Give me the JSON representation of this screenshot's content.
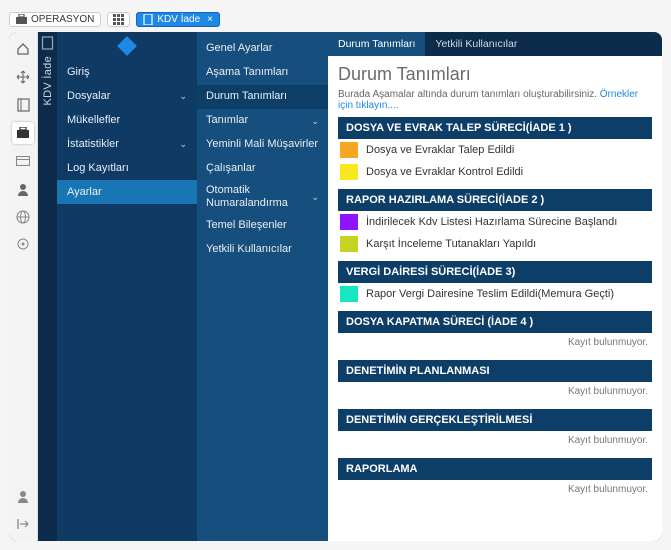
{
  "topbar": {
    "operasyon": "OPERASYON",
    "tab_label": "KDV İade",
    "tab_close": "×"
  },
  "vtab": {
    "label": "KDV İade"
  },
  "nav1": {
    "items": [
      {
        "label": "Giriş",
        "expandable": false,
        "active": false
      },
      {
        "label": "Dosyalar",
        "expandable": true,
        "active": false
      },
      {
        "label": "Mükellefler",
        "expandable": false,
        "active": false
      },
      {
        "label": "İstatistikler",
        "expandable": true,
        "active": false
      },
      {
        "label": "Log Kayıtları",
        "expandable": false,
        "active": false
      },
      {
        "label": "Ayarlar",
        "expandable": false,
        "active": true
      }
    ]
  },
  "nav2": {
    "items": [
      {
        "label": "Genel Ayarlar",
        "expandable": false,
        "active": false
      },
      {
        "label": "Aşama Tanımları",
        "expandable": false,
        "active": false
      },
      {
        "label": "Durum Tanımları",
        "expandable": false,
        "active": true
      },
      {
        "label": "Tanımlar",
        "expandable": true,
        "active": false
      },
      {
        "label": "Yeminli Mali Müşavirler",
        "expandable": false,
        "active": false
      },
      {
        "label": "Çalışanlar",
        "expandable": false,
        "active": false
      },
      {
        "label": "Otomatik Numaralandırma",
        "expandable": true,
        "active": false
      },
      {
        "label": "Temel Bileşenler",
        "expandable": false,
        "active": false
      },
      {
        "label": "Yetkili Kullanıcılar",
        "expandable": false,
        "active": false
      }
    ]
  },
  "tabs": [
    {
      "label": "Durum Tanımları",
      "active": true
    },
    {
      "label": "Yetkili Kullanıcılar",
      "active": false
    }
  ],
  "page": {
    "title": "Durum Tanımları",
    "intro_text": "Burada Aşamalar altında durum tanımları oluşturabilirsiniz. ",
    "intro_link": "Örnekler için tıklayın....",
    "empty_text": "Kayıt bulunmuyor."
  },
  "sections": [
    {
      "title": "DOSYA VE EVRAK TALEP SÜRECİ(İADE 1 )",
      "rows": [
        {
          "color": "#f5a623",
          "label": "Dosya ve Evraklar Talep Edildi"
        },
        {
          "color": "#f8e71c",
          "label": "Dosya ve Evraklar Kontrol Edildi"
        }
      ],
      "empty": false
    },
    {
      "title": "RAPOR HAZIRLAMA SÜRECİ(İADE 2 )",
      "rows": [
        {
          "color": "#9013fe",
          "label": "İndirilecek Kdv Listesi Hazırlama Sürecine Başlandı"
        },
        {
          "color": "#c6d420",
          "label": "Karşıt İnceleme Tutanakları Yapıldı"
        }
      ],
      "empty": false
    },
    {
      "title": "VERGİ DAİRESİ SÜRECİ(İADE 3)",
      "rows": [
        {
          "color": "#16e6c1",
          "label": "Rapor Vergi Dairesine Teslim Edildi(Memura Geçti)"
        }
      ],
      "empty": false
    },
    {
      "title": "DOSYA KAPATMA SÜRECİ (İADE 4 )",
      "rows": [],
      "empty": true
    },
    {
      "title": "DENETİMİN PLANLANMASI",
      "rows": [],
      "empty": true
    },
    {
      "title": "DENETİMİN GERÇEKLEŞTİRİLMESİ",
      "rows": [],
      "empty": true
    },
    {
      "title": "RAPORLAMA",
      "rows": [],
      "empty": true
    }
  ]
}
